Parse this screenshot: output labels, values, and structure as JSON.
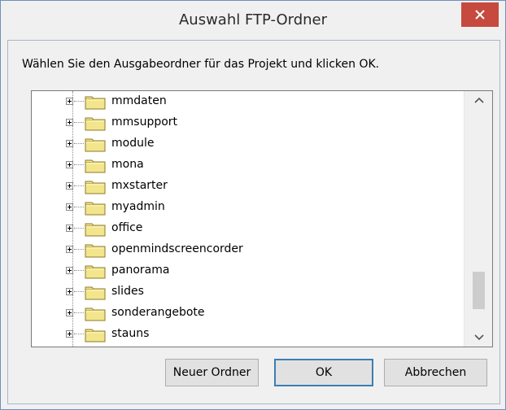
{
  "dialog": {
    "title": "Auswahl FTP-Ordner",
    "close_glyph": "✕",
    "instruction": "Wählen Sie den Ausgabeordner für das Projekt und klicken OK."
  },
  "tree": {
    "folders": [
      "mmdaten",
      "mmsupport",
      "module",
      "mona",
      "mxstarter",
      "myadmin",
      "office",
      "openmindscreencorder",
      "panorama",
      "slides",
      "sonderangebote",
      "stauns"
    ],
    "icons": {
      "expander": "plus-box-icon",
      "folder": "folder-icon"
    },
    "scrollbar": {
      "up_glyph": "⌃",
      "down_glyph": "⌄"
    }
  },
  "buttons": {
    "new_folder": "Neuer Ordner",
    "ok": "OK",
    "cancel": "Abbrechen"
  },
  "colors": {
    "close_button": "#c74a3f",
    "folder_fill": "#f2e58c",
    "ok_focus_border": "#3c7fb1"
  }
}
